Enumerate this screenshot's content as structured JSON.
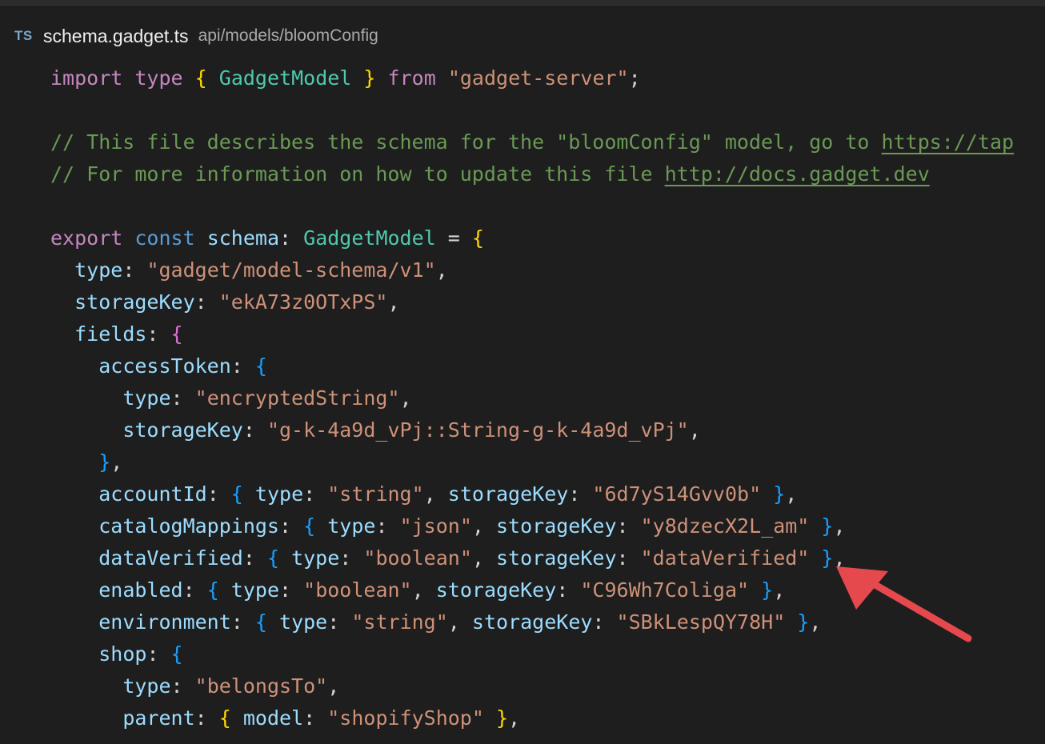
{
  "tab": {
    "language_badge": "TS",
    "filename": "schema.gadget.ts",
    "path": "api/models/bloomConfig"
  },
  "code": {
    "l1": {
      "import": "import",
      "type": "type",
      "brace_open": "{",
      "name": "GadgetModel",
      "brace_close": "}",
      "from": "from",
      "module": "\"gadget-server\"",
      "semi": ";"
    },
    "l3": "// This file describes the schema for the \"bloomConfig\" model, go to ",
    "l3_link": "https://tap",
    "l4": "// For more information on how to update this file ",
    "l4_link": "http://docs.gadget.dev",
    "l6": {
      "export": "export",
      "const": "const",
      "name": "schema",
      "colon": ":",
      "type": "GadgetModel",
      "eq": "=",
      "brace": "{"
    },
    "l7": {
      "key": "type",
      "value": "\"gadget/model-schema/v1\""
    },
    "l8": {
      "key": "storageKey",
      "value": "\"ekA73z0OTxPS\""
    },
    "l9": {
      "key": "fields",
      "brace": "{"
    },
    "l10": {
      "key": "accessToken",
      "brace": "{"
    },
    "l11": {
      "key": "type",
      "value": "\"encryptedString\""
    },
    "l12": {
      "key": "storageKey",
      "value": "\"g-k-4a9d_vPj::String-g-k-4a9d_vPj\""
    },
    "l13": {
      "brace": "}",
      "comma": ","
    },
    "fields": [
      {
        "name": "accountId",
        "type": "\"string\"",
        "storageKey": "\"6d7yS14Gvv0b\""
      },
      {
        "name": "catalogMappings",
        "type": "\"json\"",
        "storageKey": "\"y8dzecX2L_am\""
      },
      {
        "name": "dataVerified",
        "type": "\"boolean\"",
        "storageKey": "\"dataVerified\""
      },
      {
        "name": "enabled",
        "type": "\"boolean\"",
        "storageKey": "\"C96Wh7Coliga\""
      },
      {
        "name": "environment",
        "type": "\"string\"",
        "storageKey": "\"SBkLespQY78H\""
      }
    ],
    "l19": {
      "key": "shop",
      "brace": "{"
    },
    "l20": {
      "key": "type",
      "value": "\"belongsTo\""
    },
    "l21": {
      "key": "parent",
      "model_key": "model",
      "model_value": "\"shopifyShop\""
    },
    "tokens": {
      "type_key": "type",
      "storage_key": "storageKey",
      "colon": ": ",
      "comma": ",",
      "obrace": "{",
      "cbrace": "}"
    }
  },
  "annotation": {
    "color": "#e5484d",
    "points_to": "dataVerified line"
  }
}
